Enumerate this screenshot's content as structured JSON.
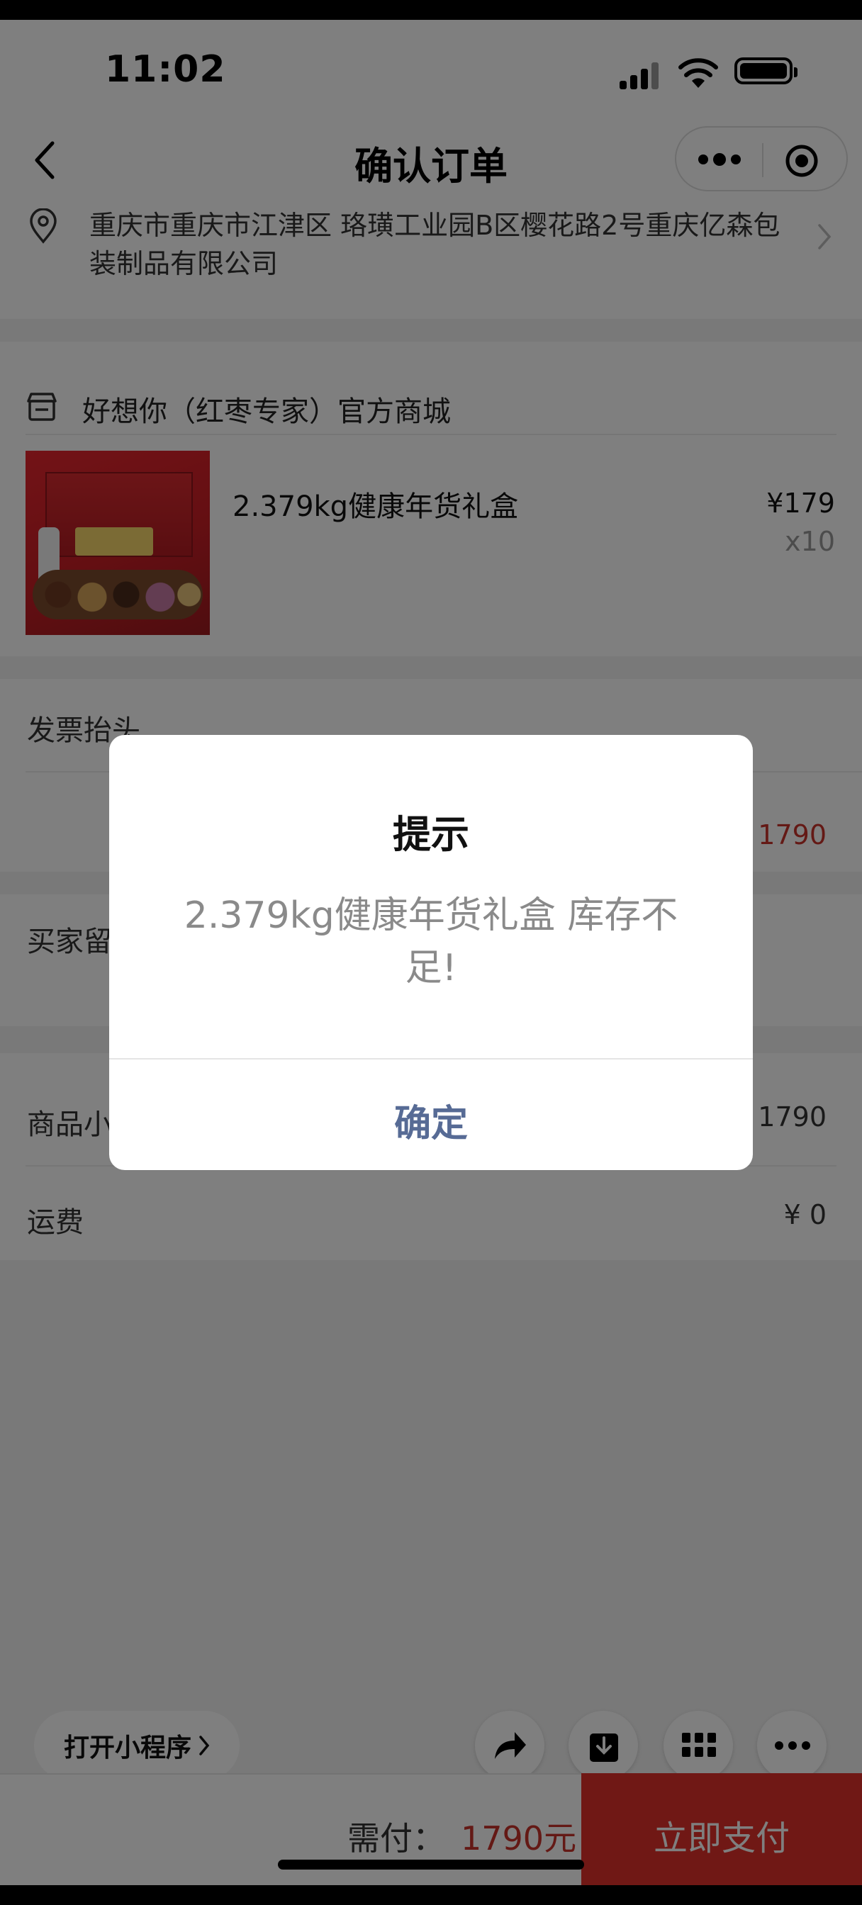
{
  "status_bar": {
    "time": "11:02"
  },
  "nav": {
    "title": "确认订单"
  },
  "address": {
    "text": "重庆市重庆市江津区 珞璜工业园B区樱花路2号重庆亿森包装制品有限公司"
  },
  "store": {
    "name": "好想你（红枣专家）官方商城"
  },
  "product": {
    "name": "2.379kg健康年货礼盒",
    "price": "¥179",
    "quantity": "x10"
  },
  "invoice": {
    "label": "发票抬头"
  },
  "subtotal_row": {
    "amount": "¥ 1790"
  },
  "buyer_note": {
    "label": "买家留"
  },
  "goods_subtotal": {
    "label": "商品小",
    "value": "¥ 1790"
  },
  "shipping": {
    "label": "运费",
    "value": "¥ 0"
  },
  "floating": {
    "open_miniprogram": "打开小程序"
  },
  "bottom_bar": {
    "need_pay_label": "需付：",
    "need_pay_amount": "1790元",
    "pay_button": "立即支付"
  },
  "dialog": {
    "title": "提示",
    "message": "2.379kg健康年货礼盒  库存不足!",
    "confirm": "确定"
  },
  "colors": {
    "price_red": "#c8322b",
    "pay_button_red": "#e0302a",
    "dialog_button_blue": "#576b95"
  }
}
